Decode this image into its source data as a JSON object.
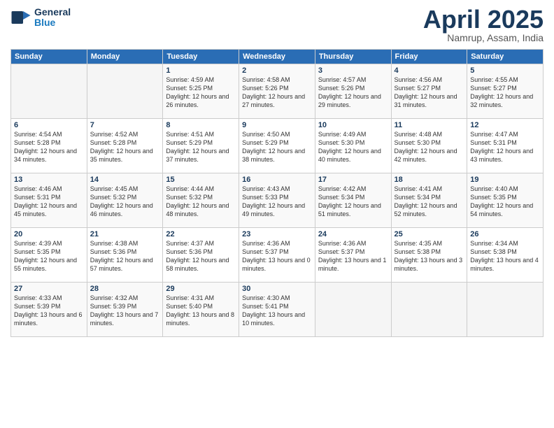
{
  "header": {
    "logo_general": "General",
    "logo_blue": "Blue",
    "title": "April 2025",
    "location": "Namrup, Assam, India"
  },
  "columns": [
    "Sunday",
    "Monday",
    "Tuesday",
    "Wednesday",
    "Thursday",
    "Friday",
    "Saturday"
  ],
  "weeks": [
    [
      {
        "day": "",
        "info": ""
      },
      {
        "day": "",
        "info": ""
      },
      {
        "day": "1",
        "info": "Sunrise: 4:59 AM\nSunset: 5:25 PM\nDaylight: 12 hours\nand 26 minutes."
      },
      {
        "day": "2",
        "info": "Sunrise: 4:58 AM\nSunset: 5:26 PM\nDaylight: 12 hours\nand 27 minutes."
      },
      {
        "day": "3",
        "info": "Sunrise: 4:57 AM\nSunset: 5:26 PM\nDaylight: 12 hours\nand 29 minutes."
      },
      {
        "day": "4",
        "info": "Sunrise: 4:56 AM\nSunset: 5:27 PM\nDaylight: 12 hours\nand 31 minutes."
      },
      {
        "day": "5",
        "info": "Sunrise: 4:55 AM\nSunset: 5:27 PM\nDaylight: 12 hours\nand 32 minutes."
      }
    ],
    [
      {
        "day": "6",
        "info": "Sunrise: 4:54 AM\nSunset: 5:28 PM\nDaylight: 12 hours\nand 34 minutes."
      },
      {
        "day": "7",
        "info": "Sunrise: 4:52 AM\nSunset: 5:28 PM\nDaylight: 12 hours\nand 35 minutes."
      },
      {
        "day": "8",
        "info": "Sunrise: 4:51 AM\nSunset: 5:29 PM\nDaylight: 12 hours\nand 37 minutes."
      },
      {
        "day": "9",
        "info": "Sunrise: 4:50 AM\nSunset: 5:29 PM\nDaylight: 12 hours\nand 38 minutes."
      },
      {
        "day": "10",
        "info": "Sunrise: 4:49 AM\nSunset: 5:30 PM\nDaylight: 12 hours\nand 40 minutes."
      },
      {
        "day": "11",
        "info": "Sunrise: 4:48 AM\nSunset: 5:30 PM\nDaylight: 12 hours\nand 42 minutes."
      },
      {
        "day": "12",
        "info": "Sunrise: 4:47 AM\nSunset: 5:31 PM\nDaylight: 12 hours\nand 43 minutes."
      }
    ],
    [
      {
        "day": "13",
        "info": "Sunrise: 4:46 AM\nSunset: 5:31 PM\nDaylight: 12 hours\nand 45 minutes."
      },
      {
        "day": "14",
        "info": "Sunrise: 4:45 AM\nSunset: 5:32 PM\nDaylight: 12 hours\nand 46 minutes."
      },
      {
        "day": "15",
        "info": "Sunrise: 4:44 AM\nSunset: 5:32 PM\nDaylight: 12 hours\nand 48 minutes."
      },
      {
        "day": "16",
        "info": "Sunrise: 4:43 AM\nSunset: 5:33 PM\nDaylight: 12 hours\nand 49 minutes."
      },
      {
        "day": "17",
        "info": "Sunrise: 4:42 AM\nSunset: 5:34 PM\nDaylight: 12 hours\nand 51 minutes."
      },
      {
        "day": "18",
        "info": "Sunrise: 4:41 AM\nSunset: 5:34 PM\nDaylight: 12 hours\nand 52 minutes."
      },
      {
        "day": "19",
        "info": "Sunrise: 4:40 AM\nSunset: 5:35 PM\nDaylight: 12 hours\nand 54 minutes."
      }
    ],
    [
      {
        "day": "20",
        "info": "Sunrise: 4:39 AM\nSunset: 5:35 PM\nDaylight: 12 hours\nand 55 minutes."
      },
      {
        "day": "21",
        "info": "Sunrise: 4:38 AM\nSunset: 5:36 PM\nDaylight: 12 hours\nand 57 minutes."
      },
      {
        "day": "22",
        "info": "Sunrise: 4:37 AM\nSunset: 5:36 PM\nDaylight: 12 hours\nand 58 minutes."
      },
      {
        "day": "23",
        "info": "Sunrise: 4:36 AM\nSunset: 5:37 PM\nDaylight: 13 hours\nand 0 minutes."
      },
      {
        "day": "24",
        "info": "Sunrise: 4:36 AM\nSunset: 5:37 PM\nDaylight: 13 hours\nand 1 minute."
      },
      {
        "day": "25",
        "info": "Sunrise: 4:35 AM\nSunset: 5:38 PM\nDaylight: 13 hours\nand 3 minutes."
      },
      {
        "day": "26",
        "info": "Sunrise: 4:34 AM\nSunset: 5:38 PM\nDaylight: 13 hours\nand 4 minutes."
      }
    ],
    [
      {
        "day": "27",
        "info": "Sunrise: 4:33 AM\nSunset: 5:39 PM\nDaylight: 13 hours\nand 6 minutes."
      },
      {
        "day": "28",
        "info": "Sunrise: 4:32 AM\nSunset: 5:39 PM\nDaylight: 13 hours\nand 7 minutes."
      },
      {
        "day": "29",
        "info": "Sunrise: 4:31 AM\nSunset: 5:40 PM\nDaylight: 13 hours\nand 8 minutes."
      },
      {
        "day": "30",
        "info": "Sunrise: 4:30 AM\nSunset: 5:41 PM\nDaylight: 13 hours\nand 10 minutes."
      },
      {
        "day": "",
        "info": ""
      },
      {
        "day": "",
        "info": ""
      },
      {
        "day": "",
        "info": ""
      }
    ]
  ]
}
